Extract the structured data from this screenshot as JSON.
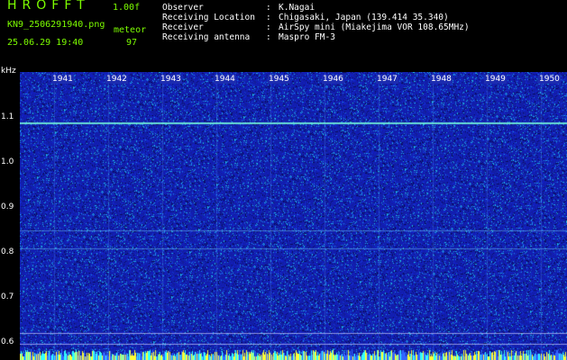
{
  "header": {
    "app_title": "HROFFT",
    "version": "1.00f",
    "filename": "KN9_2506291940.png",
    "mode": "meteor",
    "timestamp": "25.06.29 19:40",
    "count": "97",
    "info": [
      {
        "label": "Observer",
        "sep": ":",
        "value": "K.Nagai"
      },
      {
        "label": "Receiving Location",
        "sep": ":",
        "value": "Chigasaki, Japan (139.414 35.340)"
      },
      {
        "label": "Receiver",
        "sep": ":",
        "value": "AirSpy mini (Miakejima VOR 108.65MHz)"
      },
      {
        "label": "Receiving antenna",
        "sep": ":",
        "value": "Maspro FM-3"
      }
    ]
  },
  "axis": {
    "y_unit": "kHz",
    "y_ticks": [
      "1.1",
      "1.0",
      "0.9",
      "0.8",
      "0.7",
      "0.6"
    ],
    "x_ticks": [
      "1941",
      "1942",
      "1943",
      "1944",
      "1945",
      "1946",
      "1947",
      "1948",
      "1949",
      "1950"
    ]
  },
  "colors": {
    "background": "#1c2cb0",
    "text_green": "#7CFC00",
    "text_white": "#ffffff"
  }
}
